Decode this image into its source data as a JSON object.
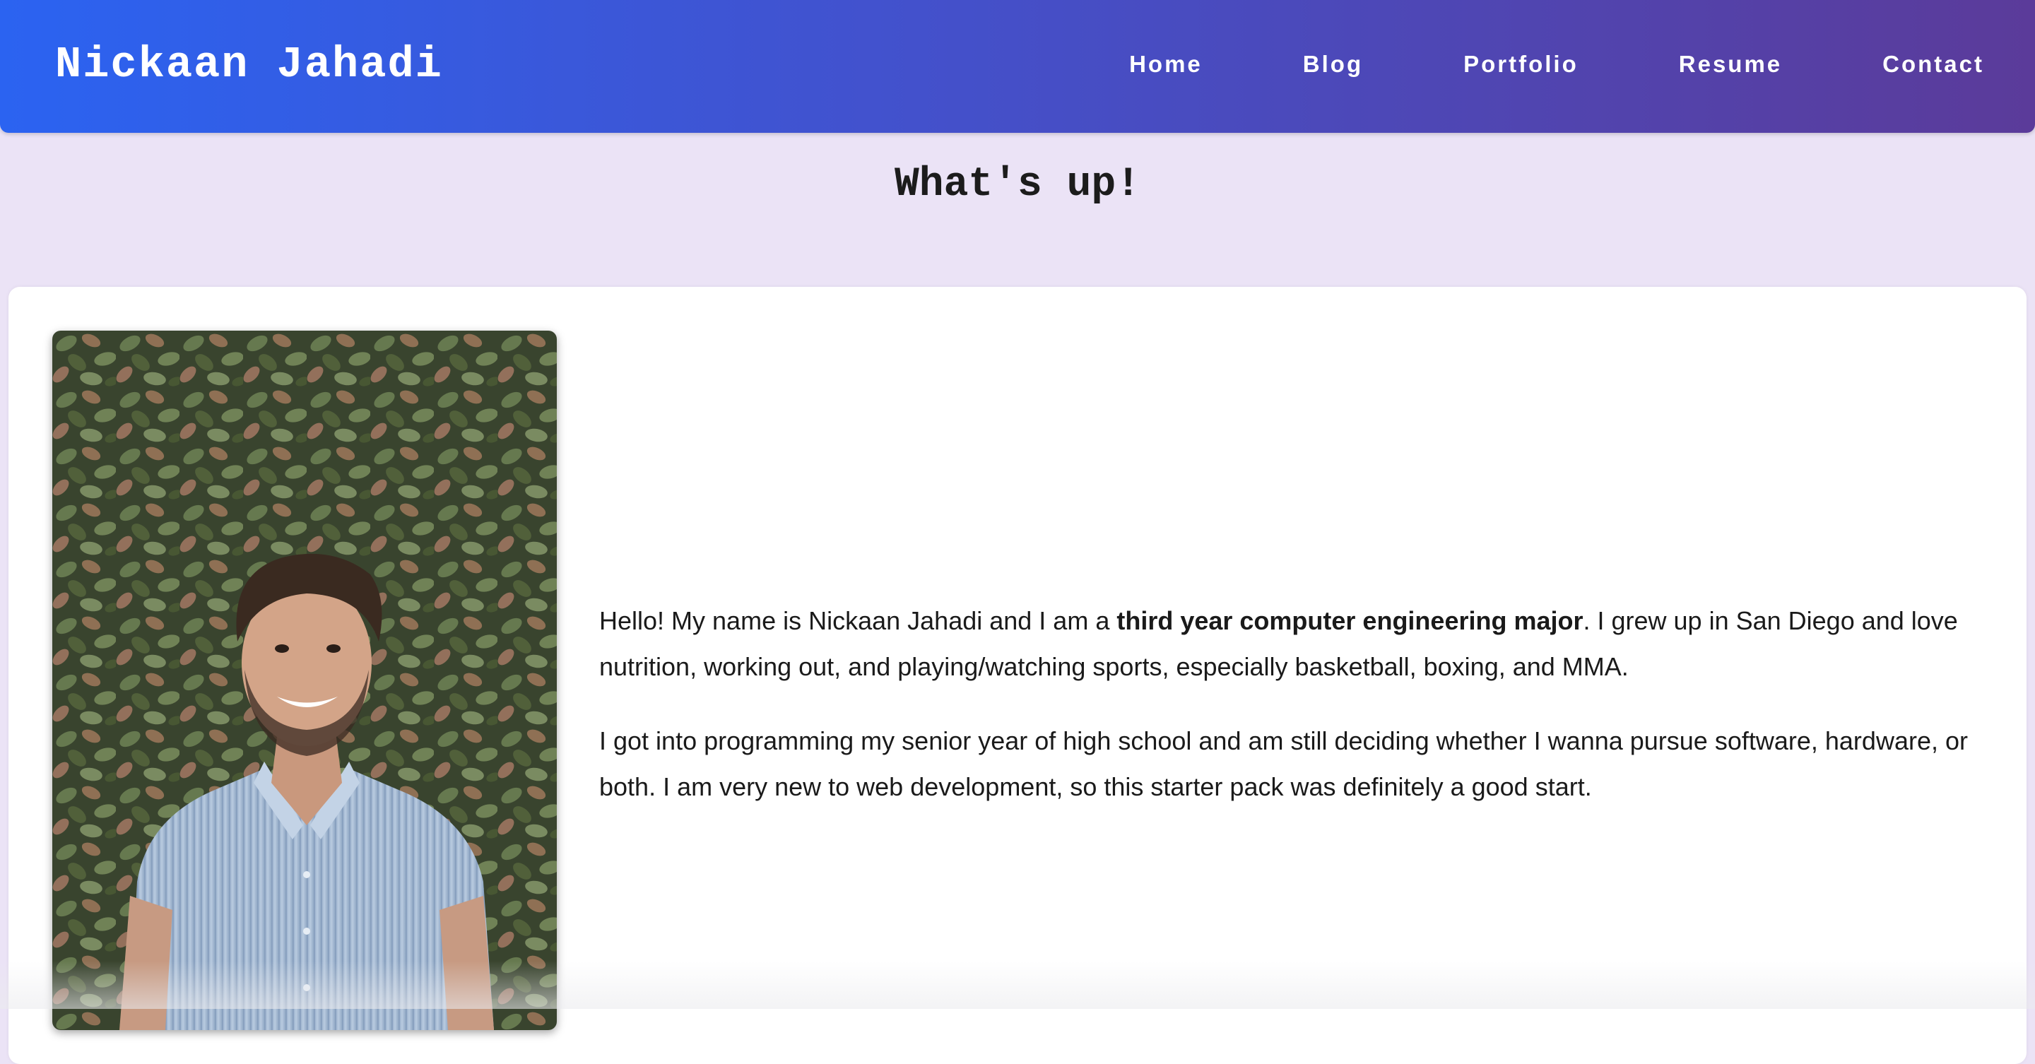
{
  "header": {
    "site_title": "Nickaan Jahadi",
    "nav": [
      {
        "label": "Home"
      },
      {
        "label": "Blog"
      },
      {
        "label": "Portfolio"
      },
      {
        "label": "Resume"
      },
      {
        "label": "Contact"
      }
    ]
  },
  "main": {
    "heading": "What's up!",
    "bio": {
      "p1_before": "Hello! My name is Nickaan Jahadi and I am a ",
      "p1_bold": "third year computer engineering major",
      "p1_after": ". I grew up in San Diego and love nutrition, working out, and playing/watching sports, especially basketball, boxing, and MMA.",
      "p2": "I got into programming my senior year of high school and am still deciding whether I wanna pursue software, hardware, or both. I am very new to web development, so this starter pack was definitely a good start."
    },
    "photo": {
      "subject": "portrait-photo"
    }
  },
  "colors": {
    "header_gradient_start": "#2b63f1",
    "header_gradient_end": "#5b3b9a",
    "page_background": "#ebe3f6",
    "card_background": "#ffffff"
  }
}
